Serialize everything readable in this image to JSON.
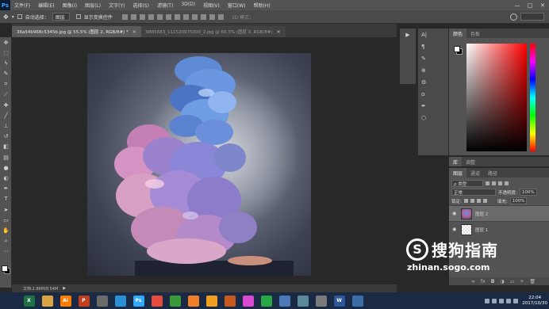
{
  "app": {
    "logo": "Ps"
  },
  "menubar": {
    "items": [
      "文件(F)",
      "编辑(E)",
      "图像(I)",
      "图层(L)",
      "文字(Y)",
      "选择(S)",
      "滤镜(T)",
      "3D(D)",
      "视图(V)",
      "窗口(W)",
      "帮助(H)"
    ],
    "window_controls": {
      "minimize": "—",
      "maximize": "□",
      "close": "✕"
    }
  },
  "options": {
    "auto_select_label": "自动选择：",
    "auto_select_value": "图层",
    "show_transform_label": "显示变换控件",
    "mode_3d_label": "3D 模式："
  },
  "tabs": [
    {
      "title": "36a54b968c5345b.jpg @ 55.5% (图层 2, RGB/8#) *",
      "active": true
    },
    {
      "title": "9885683_111520975000_2.jpg @ 60.3% (图层 0, RGB/8#)",
      "active": false
    }
  ],
  "status": {
    "doc_info": "文档:2.86M/8.54M",
    "arrow": "▶"
  },
  "color_panel": {
    "tabs": [
      "颜色",
      "色板"
    ],
    "fg_color": "#ffffff",
    "bg_color": "#000000"
  },
  "libraries_panel": {
    "tabs": [
      "库",
      "调整"
    ]
  },
  "layers_panel": {
    "tabs": [
      "图层",
      "通道",
      "路径"
    ],
    "kind_label": "ρ 类型",
    "blend_mode": "正常",
    "opacity_label": "不透明度:",
    "opacity_value": "100%",
    "lock_label": "锁定:",
    "fill_label": "填充:",
    "fill_value": "100%",
    "layers": [
      {
        "name": "图层 2",
        "selected": true,
        "thumb": "art"
      },
      {
        "name": "图层 1",
        "selected": false,
        "thumb": "blank"
      }
    ]
  },
  "watermark": {
    "logo": "S",
    "text": "搜狗指南",
    "url": "zhinan.sogo.com"
  },
  "taskbar": {
    "apps": [
      {
        "label": "X",
        "color": "#1e7145"
      },
      {
        "label": "",
        "color": "#d9a441"
      },
      {
        "label": "Ai",
        "color": "#ff7c00"
      },
      {
        "label": "P",
        "color": "#c43e1c"
      },
      {
        "label": "",
        "color": "#6a6a6a"
      },
      {
        "label": "",
        "color": "#2b8fd6"
      },
      {
        "label": "Ps",
        "color": "#31a8ff"
      },
      {
        "label": "",
        "color": "#e64a3c"
      },
      {
        "label": "",
        "color": "#3a9a3a"
      },
      {
        "label": "",
        "color": "#f07f2a"
      },
      {
        "label": "",
        "color": "#f0a020"
      },
      {
        "label": "",
        "color": "#c85a20"
      },
      {
        "label": "",
        "color": "#d94ad0"
      },
      {
        "label": "",
        "color": "#28a745"
      },
      {
        "label": "",
        "color": "#4a7ab8"
      },
      {
        "label": "",
        "color": "#5a8a9a"
      },
      {
        "label": "",
        "color": "#7a7a7a"
      },
      {
        "label": "W",
        "color": "#2b579a"
      },
      {
        "label": "",
        "color": "#3a6ea5"
      }
    ],
    "time": "22:04",
    "date": "2017/10/30"
  }
}
